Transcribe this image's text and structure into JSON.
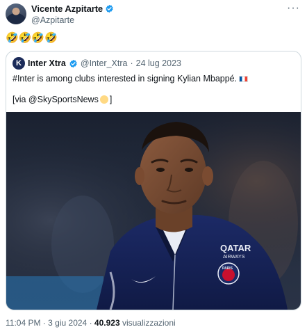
{
  "author": {
    "name": "Vicente Azpitarte",
    "handle": "@Azpitarte",
    "verified": true
  },
  "more_icon": "more-horizontal-icon",
  "tweet_text": "🤣🤣🤣🤣",
  "quote": {
    "avatar_letter": "K",
    "name": "Inter Xtra",
    "verified": true,
    "handle": "@Inter_Xtra",
    "dot": "·",
    "date": "24 lug 2023",
    "text": "#Inter is among clubs interested in signing Kylian Mbappé.",
    "text_flag": "french-flag-emoji",
    "via_prefix": "[via @SkySportsNews",
    "via_emoji": "sun-emoji",
    "via_suffix": "]",
    "media": {
      "jersey_sponsor": "QATAR",
      "jersey_sponsor_sub": "AIRWAYS",
      "crest_text": "PARIS"
    }
  },
  "meta": {
    "time": "11:04 PM",
    "dot1": "·",
    "date": "3 giu 2024",
    "dot2": "·",
    "views": "40.923",
    "views_label": "visualizzazioni"
  },
  "colors": {
    "text": "#0f1419",
    "secondary": "#536471",
    "verified": "#1d9bf0",
    "border": "#cfd9de"
  }
}
